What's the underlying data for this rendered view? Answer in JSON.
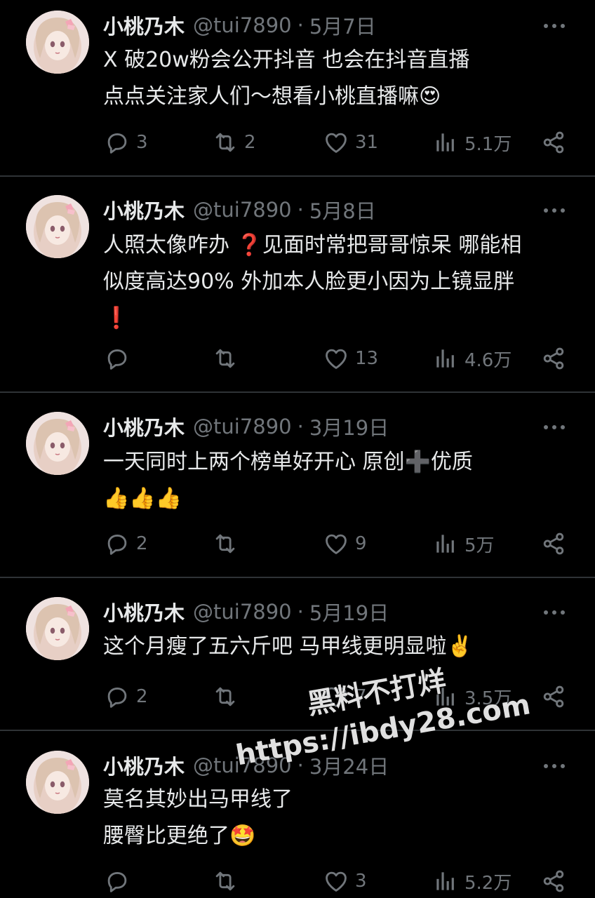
{
  "colors": {
    "background": "#000000",
    "text_primary": "#e7e9ea",
    "text_secondary": "#71767b",
    "divider": "#2f3336"
  },
  "watermark": {
    "line1": "黑料不打烊",
    "line2": "https://ibdy28.com"
  },
  "tweets": [
    {
      "name": "小桃乃木",
      "handle": "@tui7890",
      "separator": "·",
      "date": "5月7日",
      "lines": [
        "X 破20w粉会公开抖音 也会在抖音直播",
        "点点关注家人们～想看小桃直播嘛😍"
      ],
      "replies": "3",
      "retweets": "2",
      "likes": "31",
      "views": "5.1万",
      "icons": [
        "avatar",
        "more-icon",
        "reply-icon",
        "retweet-icon",
        "like-icon",
        "views-icon",
        "share-icon"
      ]
    },
    {
      "name": "小桃乃木",
      "handle": "@tui7890",
      "separator": "·",
      "date": "5月8日",
      "lines": [
        "人照太像咋办 ❓见面时常把哥哥惊呆 哪能相",
        "似度高达90% 外加本人脸更小因为上镜显胖",
        "❗"
      ],
      "replies": "",
      "retweets": "",
      "likes": "13",
      "views": "4.6万"
    },
    {
      "name": "小桃乃木",
      "handle": "@tui7890",
      "separator": "·",
      "date": "3月19日",
      "lines": [
        "一天同时上两个榜单好开心 原创➕优质",
        "👍👍👍"
      ],
      "replies": "2",
      "retweets": "",
      "likes": "9",
      "views": "5万"
    },
    {
      "name": "小桃乃木",
      "handle": "@tui7890",
      "separator": "·",
      "date": "5月19日",
      "lines": [
        "这个月瘦了五六斤吧 马甲线更明显啦✌️"
      ],
      "replies": "2",
      "retweets": "",
      "likes": "7",
      "views": "3.5万"
    },
    {
      "name": "小桃乃木",
      "handle": "@tui7890",
      "separator": "·",
      "date": "3月24日",
      "lines": [
        "莫名其妙出马甲线了",
        "腰臀比更绝了🤩"
      ],
      "replies": "",
      "retweets": "",
      "likes": "3",
      "views": "5.2万"
    }
  ]
}
